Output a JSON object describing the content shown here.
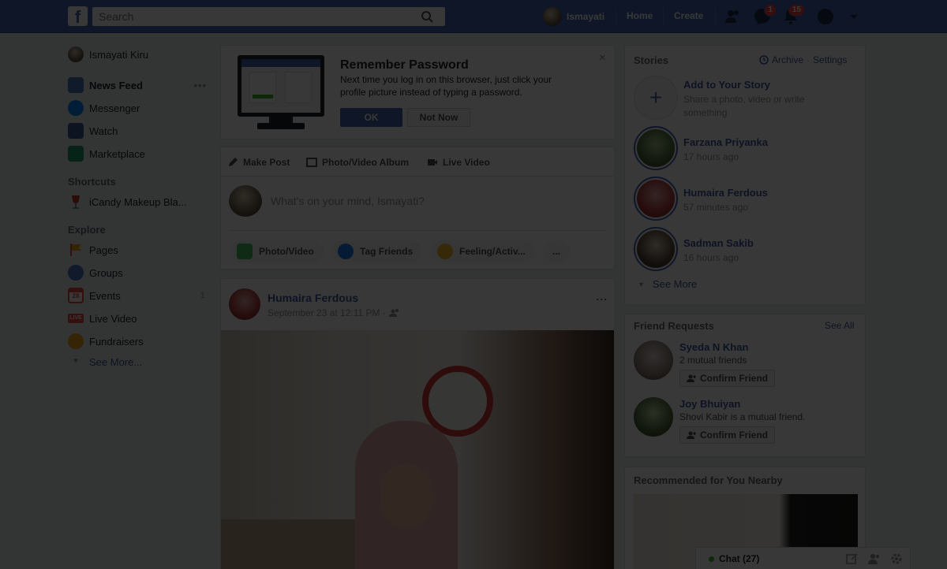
{
  "header": {
    "search_placeholder": "Search",
    "user_name": "Ismayati",
    "home": "Home",
    "create": "Create",
    "messenger_badge": "1",
    "notifications_badge": "15"
  },
  "sidebar": {
    "profile_name": "Ismayati Kiru",
    "items": [
      {
        "label": "News Feed",
        "icon": "news-feed-icon",
        "color": "#4a76c4"
      },
      {
        "label": "Messenger",
        "icon": "messenger-icon",
        "color": "#0084ff"
      },
      {
        "label": "Watch",
        "icon": "watch-icon",
        "color": "#3b5998"
      },
      {
        "label": "Marketplace",
        "icon": "marketplace-icon",
        "color": "#1e9e6c"
      }
    ],
    "shortcuts_heading": "Shortcuts",
    "shortcuts": [
      {
        "label": "iCandy Makeup Bla...",
        "icon": "wine-glass-icon"
      }
    ],
    "explore_heading": "Explore",
    "explore": [
      {
        "label": "Pages",
        "icon": "flag-icon",
        "color": "#f5a623"
      },
      {
        "label": "Groups",
        "icon": "groups-icon",
        "color": "#4a76c4"
      },
      {
        "label": "Events",
        "icon": "calendar-icon",
        "color": "#e8453c",
        "badge": "1"
      },
      {
        "label": "Live Video",
        "icon": "live-icon",
        "color": "#e8453c"
      },
      {
        "label": "Fundraisers",
        "icon": "fundraiser-icon",
        "color": "#f5a623"
      }
    ],
    "see_more": "See More...",
    "calendar_day": "28",
    "live_text": "LIVE"
  },
  "password_card": {
    "title": "Remember Password",
    "body": "Next time you log in on this browser, just click your profile picture instead of typing a password.",
    "ok": "OK",
    "not_now": "Not Now"
  },
  "composer": {
    "tabs": [
      "Make Post",
      "Photo/Video Album",
      "Live Video"
    ],
    "placeholder": "What's on your mind, Ismayati?",
    "actions": [
      "Photo/Video",
      "Tag Friends",
      "Feeling/Activ...",
      "..."
    ]
  },
  "post": {
    "author": "Humaira Ferdous",
    "time": "September 23 at 12:11 PM ·",
    "menu": "..."
  },
  "stories": {
    "heading": "Stories",
    "archive": "Archive",
    "separator": "·",
    "settings": "Settings",
    "add_title": "Add to Your Story",
    "add_sub": "Share a photo, video or write something",
    "items": [
      {
        "name": "Farzana Priyanka",
        "time": "17 hours ago"
      },
      {
        "name": "Humaira Ferdous",
        "time": "57 minutes ago"
      },
      {
        "name": "Sadman Sakib",
        "time": "16 hours ago"
      }
    ],
    "see_more": "See More"
  },
  "friend_requests": {
    "heading": "Friend Requests",
    "see_all": "See All",
    "items": [
      {
        "name": "Syeda N Khan",
        "sub": "2 mutual friends",
        "button": "Confirm Friend"
      },
      {
        "name": "Joy Bhuiyan",
        "sub": "Shovi Kabir is a mutual friend.",
        "button": "Confirm Friend"
      }
    ]
  },
  "recommended": {
    "heading": "Recommended for You Nearby"
  },
  "chat": {
    "label": "Chat (27)"
  }
}
